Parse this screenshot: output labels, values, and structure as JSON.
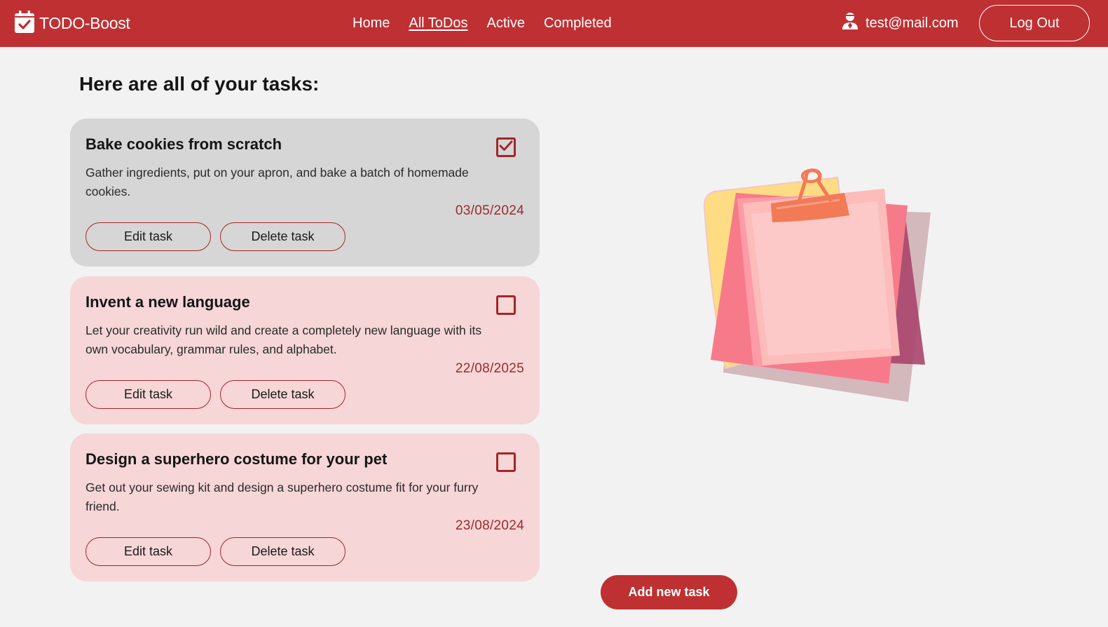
{
  "header": {
    "brand": "TODO-Boost",
    "brand_icon": "calendar-check-icon",
    "nav": [
      {
        "label": "Home",
        "active": false
      },
      {
        "label": "All ToDos",
        "active": true
      },
      {
        "label": "Active",
        "active": false
      },
      {
        "label": "Completed",
        "active": false
      }
    ],
    "user_email": "test@mail.com",
    "user_icon": "user-icon",
    "logout_label": "Log Out"
  },
  "main": {
    "title": "Here are all of your tasks:",
    "tasks": [
      {
        "title": "Bake cookies from scratch",
        "description": "Gather ingredients, put on your apron, and bake a batch of homemade cookies.",
        "date": "03/05/2024",
        "completed": true,
        "edit_label": "Edit task",
        "delete_label": "Delete task"
      },
      {
        "title": "Invent a new language",
        "description": "Let your creativity run wild and create a completely new language with its own vocabulary, grammar rules, and alphabet.",
        "date": "22/08/2025",
        "completed": false,
        "edit_label": "Edit task",
        "delete_label": "Delete task"
      },
      {
        "title": "Design a superhero costume for your pet",
        "description": "Get out your sewing kit and design a superhero costume fit for your furry friend.",
        "date": "23/08/2024",
        "completed": false,
        "edit_label": "Edit task",
        "delete_label": "Delete task"
      }
    ],
    "add_label": "Add new task",
    "illustration_icon": "clipboard-notes-illustration"
  },
  "colors": {
    "brand": "#bf3033",
    "completed_card": "#d6d6d6",
    "active_card": "#f6d6d6",
    "date": "#9b2a2d"
  }
}
